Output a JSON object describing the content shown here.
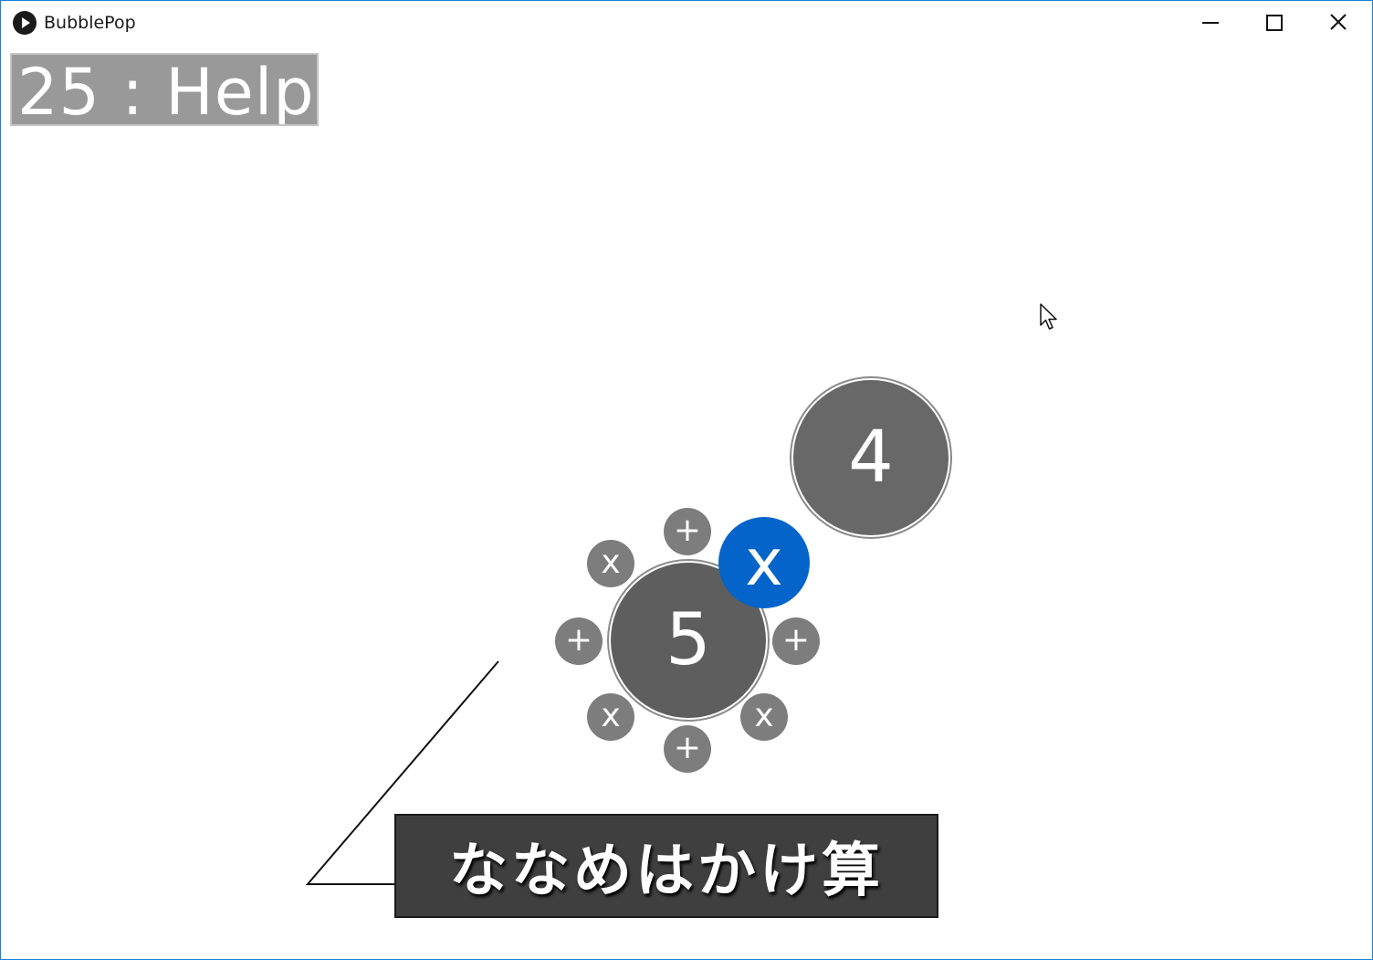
{
  "window": {
    "title": "BubblePop"
  },
  "score": {
    "text": "25 : Help"
  },
  "bubbles": {
    "four": "4",
    "five": "5",
    "active": "x"
  },
  "operators": {
    "plus": "+",
    "times": "x"
  },
  "caption": {
    "text": "ななめはかけ算"
  },
  "colors": {
    "active_bubble": "#0464c9",
    "bubble": "#686868",
    "operator": "#7d7d7d",
    "caption_bg": "#3f3f3f"
  }
}
